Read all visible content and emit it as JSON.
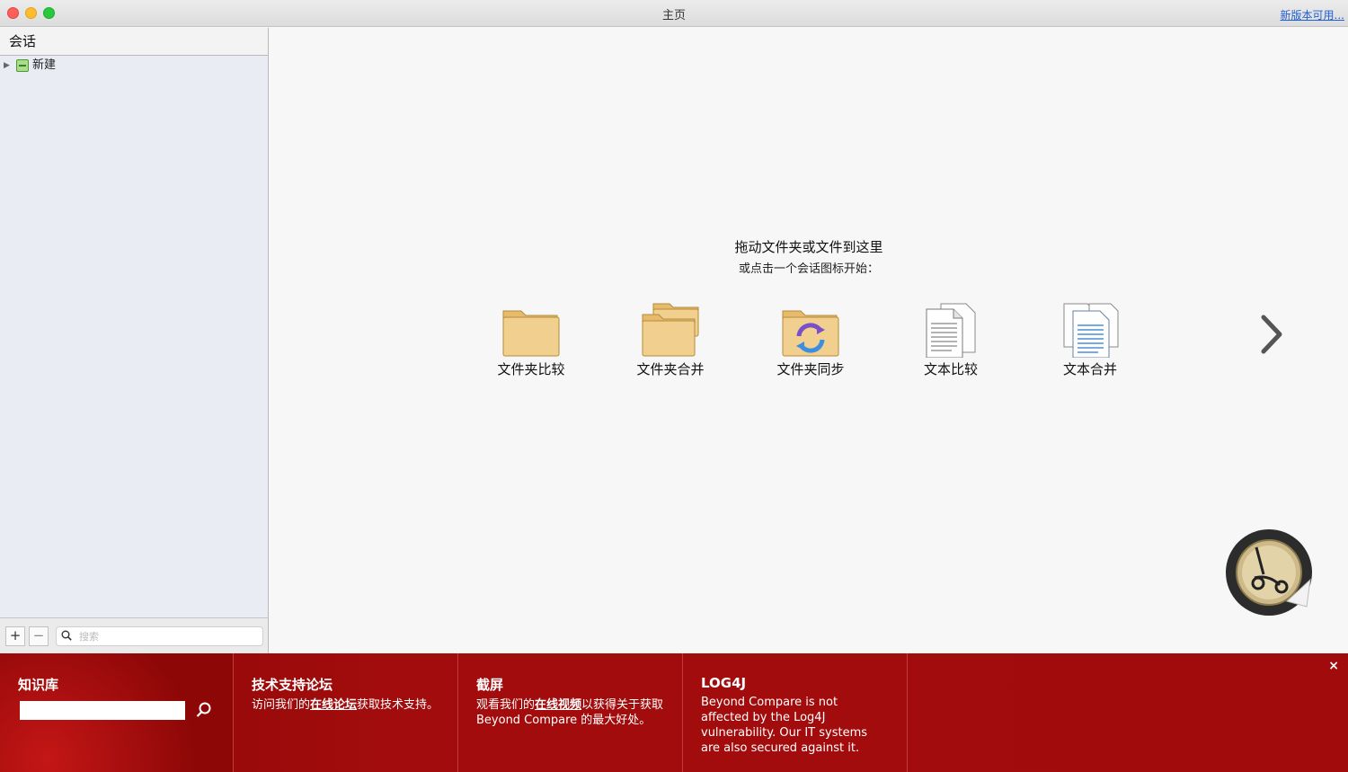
{
  "window": {
    "title": "主页",
    "new_version_link": "新版本可用..."
  },
  "sidebar": {
    "header": "会话",
    "items": [
      {
        "label": "新建",
        "icon": "session-folder-icon",
        "expanded": false
      }
    ],
    "footer": {
      "add_label": "+",
      "remove_label": "−",
      "search_placeholder": "搜索"
    }
  },
  "main": {
    "prompt_title": "拖动文件夹或文件到这里",
    "prompt_subtitle": "或点击一个会话图标开始：",
    "sessions": [
      {
        "label": "文件夹比较",
        "icon": "folder-compare-icon"
      },
      {
        "label": "文件夹合并",
        "icon": "folder-merge-icon"
      },
      {
        "label": "文件夹同步",
        "icon": "folder-sync-icon"
      },
      {
        "label": "文本比较",
        "icon": "text-compare-icon"
      },
      {
        "label": "文本合并",
        "icon": "text-merge-icon"
      }
    ]
  },
  "bottombar": {
    "knowledge_base": {
      "title": "知识库",
      "input_value": ""
    },
    "forum": {
      "title": "技术支持论坛",
      "text_before": "访问我们的",
      "link": "在线论坛",
      "text_after": "获取技术支持。"
    },
    "screenshots": {
      "title": "截屏",
      "text_before": "观看我们的",
      "link": "在线视频",
      "text_after": "以获得关于获取 Beyond Compare 的最大好处。"
    },
    "log4j": {
      "title": "LOG4J",
      "text": "Beyond Compare is not affected by the Log4J vulnerability. Our IT systems are also secured against it."
    },
    "close_label": "×"
  },
  "colors": {
    "banner_red": "#a10b0b",
    "link_blue": "#1f5fd6",
    "folder_tan": "#f1d08f"
  }
}
